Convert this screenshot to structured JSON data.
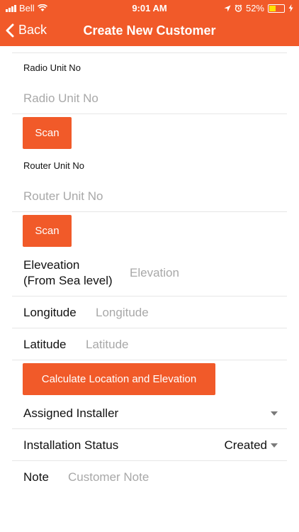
{
  "status_bar": {
    "carrier": "Bell",
    "time": "9:01 AM",
    "battery_percent": "52%",
    "battery_level": 0.52,
    "icons": [
      "signal-icon",
      "wifi-icon",
      "location-icon",
      "alarm-icon",
      "battery-icon",
      "charging-icon"
    ]
  },
  "nav": {
    "back_label": "Back",
    "title": "Create New Customer"
  },
  "form": {
    "radio_unit": {
      "label": "Radio Unit No",
      "placeholder": "Radio Unit No",
      "scan_label": "Scan"
    },
    "router_unit": {
      "label": "Router Unit No",
      "placeholder": "Router Unit No",
      "scan_label": "Scan"
    },
    "elevation": {
      "label_line1": "Eleveation",
      "label_line2": "(From Sea level)",
      "placeholder": "Elevation"
    },
    "longitude": {
      "label": "Longitude",
      "placeholder": "Longitude"
    },
    "latitude": {
      "label": "Latitude",
      "placeholder": "Latitude"
    },
    "calculate_label": "Calculate Location and Elevation",
    "assigned_installer": {
      "label": "Assigned Installer",
      "value": ""
    },
    "installation_status": {
      "label": "Installation Status",
      "value": "Created"
    },
    "note": {
      "label": "Note",
      "placeholder": "Customer Note"
    }
  },
  "colors": {
    "accent": "#f15a29",
    "separator": "#e6e6e6",
    "placeholder": "#a8a8a8"
  }
}
